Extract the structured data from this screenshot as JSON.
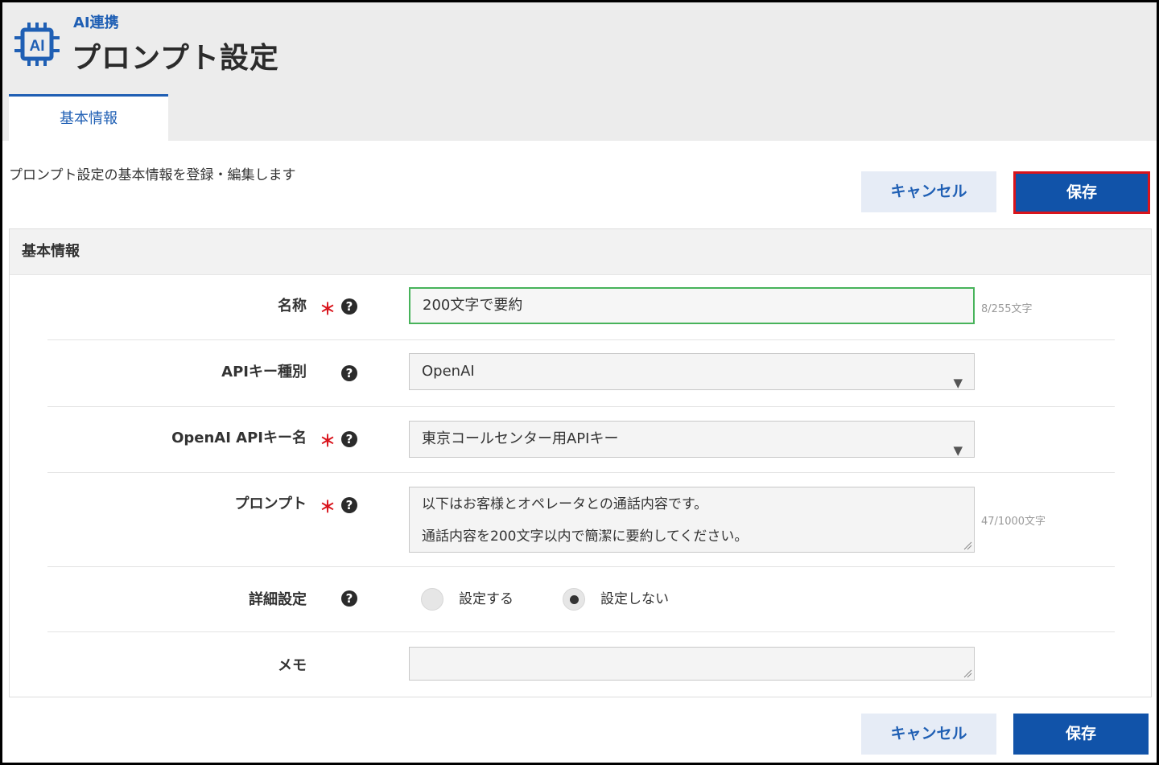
{
  "header": {
    "breadcrumb": "AI連携",
    "title": "プロンプト設定",
    "icon": "ai-chip-icon"
  },
  "tabs": [
    {
      "label": "基本情報",
      "active": true
    }
  ],
  "description": "プロンプト設定の基本情報を登録・編集します",
  "actions": {
    "cancel_label": "キャンセル",
    "save_label": "保存"
  },
  "panel": {
    "title": "基本情報",
    "fields": {
      "name": {
        "label": "名称",
        "required": true,
        "value": "200文字で要約",
        "counter": "8/255文字"
      },
      "api_key_type": {
        "label": "APIキー種別",
        "required": false,
        "value": "OpenAI"
      },
      "openai_key_name": {
        "label": "OpenAI APIキー名",
        "required": true,
        "value": "東京コールセンター用APIキー"
      },
      "prompt": {
        "label": "プロンプト",
        "required": true,
        "lines": [
          "以下はお客様とオペレータとの通話内容です。",
          "通話内容を200文字以内で簡潔に要約してください。"
        ],
        "counter": "47/1000文字"
      },
      "advanced": {
        "label": "詳細設定",
        "options": [
          {
            "label": "設定する",
            "checked": false
          },
          {
            "label": "設定しない",
            "checked": true
          }
        ]
      },
      "memo": {
        "label": "メモ",
        "value": ""
      }
    },
    "required_mark": "＊",
    "help_mark": "?"
  },
  "colors": {
    "accent": "#1f5fb4",
    "save_button": "#1153a9",
    "highlight": "#d9141c",
    "active_field_border": "#47b35a"
  }
}
